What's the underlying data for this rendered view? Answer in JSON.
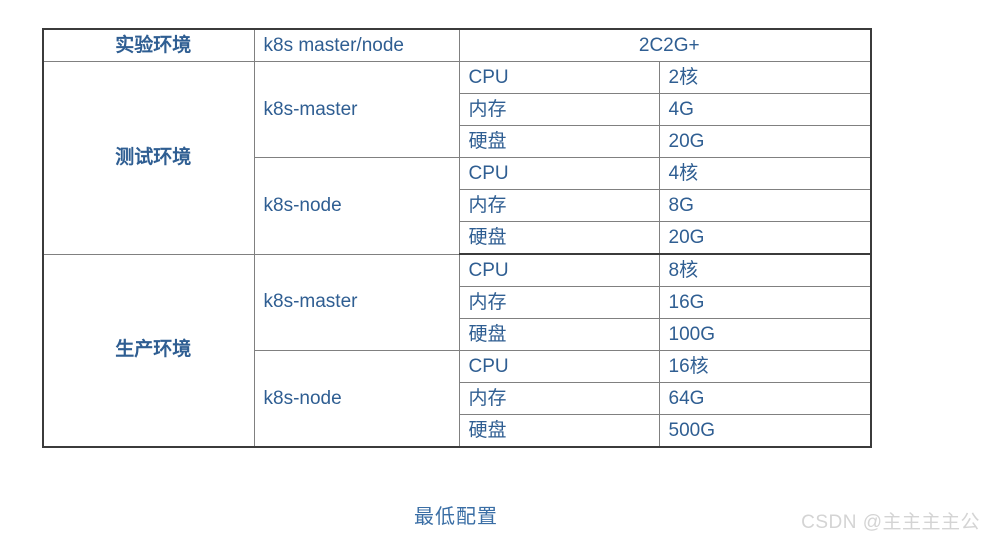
{
  "table": {
    "header": {
      "env": "实验环境",
      "node": "k8s master/node",
      "spec": "2C2G+"
    },
    "sections": [
      {
        "env": "测试环境",
        "groups": [
          {
            "node": "k8s-master",
            "rows": [
              {
                "resource": "CPU",
                "value": "2核"
              },
              {
                "resource": "内存",
                "value": "4G"
              },
              {
                "resource": "硬盘",
                "value": "20G"
              }
            ]
          },
          {
            "node": "k8s-node",
            "rows": [
              {
                "resource": "CPU",
                "value": "4核"
              },
              {
                "resource": "内存",
                "value": "8G"
              },
              {
                "resource": "硬盘",
                "value": "20G"
              }
            ]
          }
        ]
      },
      {
        "env": "生产环境",
        "groups": [
          {
            "node": "k8s-master",
            "rows": [
              {
                "resource": "CPU",
                "value": "8核"
              },
              {
                "resource": "内存",
                "value": "16G"
              },
              {
                "resource": "硬盘",
                "value": "100G"
              }
            ]
          },
          {
            "node": "k8s-node",
            "rows": [
              {
                "resource": "CPU",
                "value": "16核"
              },
              {
                "resource": "内存",
                "value": "64G"
              },
              {
                "resource": "硬盘",
                "value": "500G"
              }
            ]
          }
        ]
      }
    ]
  },
  "caption": "最低配置",
  "watermark": "CSDN @主主主主公",
  "colors": {
    "outer_border": "#3b3b3b",
    "inner_border": "#808080",
    "text": "#2f5e92",
    "env_label": "#1f3864",
    "caption": "#3a6ea5",
    "watermark": "#d4d4d4",
    "background": "#ffffff"
  }
}
